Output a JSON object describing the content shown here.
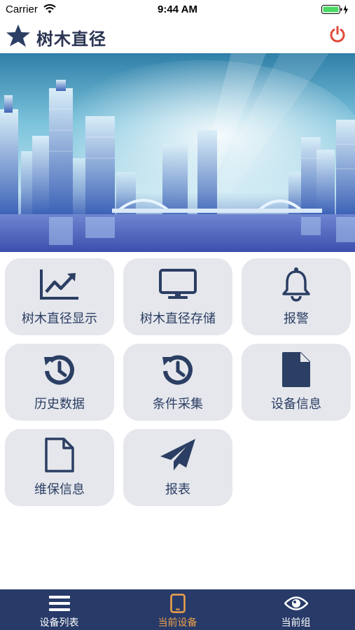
{
  "status_bar": {
    "carrier": "Carrier",
    "time": "9:44 AM"
  },
  "header": {
    "title": "树木直径",
    "logo_icon": "star-icon",
    "power_icon": "power-icon",
    "power_color": "#e04a3c"
  },
  "banner": {
    "image": "city-skyline"
  },
  "tiles": [
    {
      "label": "树木直径显示",
      "icon": "trend-chart-icon"
    },
    {
      "label": "树木直径存储",
      "icon": "monitor-icon"
    },
    {
      "label": "报警",
      "icon": "bell-icon"
    },
    {
      "label": "历史数据",
      "icon": "history-icon"
    },
    {
      "label": "条件采集",
      "icon": "history-icon"
    },
    {
      "label": "设备信息",
      "icon": "file-filled-icon"
    },
    {
      "label": "维保信息",
      "icon": "file-outline-icon"
    },
    {
      "label": "报表",
      "icon": "paper-plane-icon"
    }
  ],
  "tab_bar": {
    "items": [
      {
        "label": "设备列表",
        "icon": "list-icon",
        "active": false
      },
      {
        "label": "当前设备",
        "icon": "tablet-icon",
        "active": true
      },
      {
        "label": "当前组",
        "icon": "eye-icon",
        "active": false
      }
    ],
    "background": "#273a68",
    "active_color": "#f0a24b"
  }
}
